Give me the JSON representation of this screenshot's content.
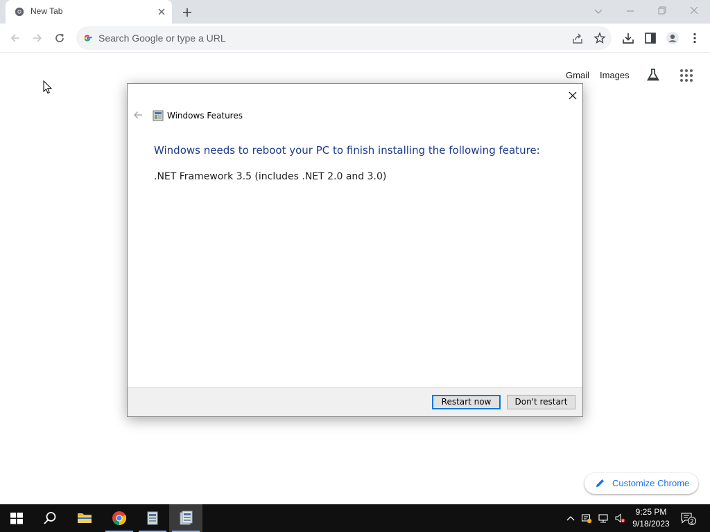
{
  "browser": {
    "tab": {
      "title": "New Tab"
    },
    "omnibox": {
      "placeholder": "Search Google or type a URL"
    }
  },
  "ntp": {
    "links": {
      "gmail": "Gmail",
      "images": "Images"
    },
    "customize_label": "Customize Chrome"
  },
  "dialog": {
    "title": "Windows Features",
    "heading": "Windows needs to reboot your PC to finish installing the following feature:",
    "feature": ".NET Framework 3.5 (includes .NET 2.0 and 3.0)",
    "buttons": {
      "restart": "Restart now",
      "dont_restart": "Don't restart"
    }
  },
  "taskbar": {
    "time": "9:25 PM",
    "date": "9/18/2023",
    "notifications": "2"
  },
  "colors": {
    "accent": "#1a73e8",
    "dialog_heading": "#1e3a8a",
    "primary_button_border": "#0078d7",
    "taskbar": "#101010"
  }
}
